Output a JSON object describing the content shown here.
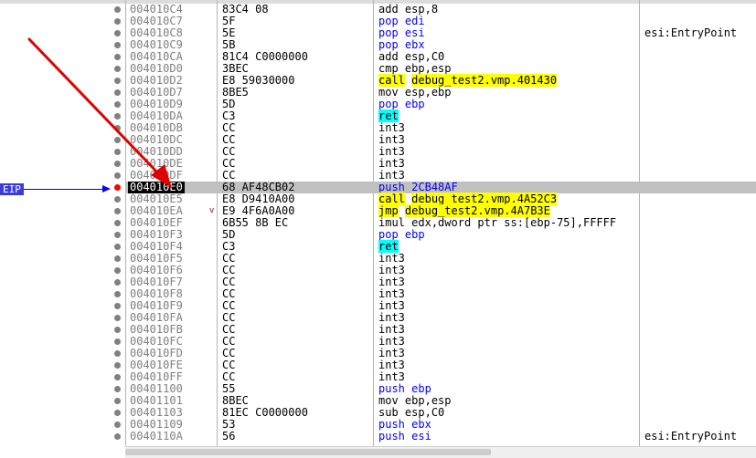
{
  "eip_marker": {
    "label": "EIP"
  },
  "rows": [
    {
      "addr": "004010C4",
      "bytes": "83C4 08",
      "mn": "add",
      "ops": "esp,8",
      "cls": "mn-default"
    },
    {
      "addr": "004010C7",
      "bytes": "5F",
      "mn": "pop",
      "ops": "edi",
      "cls": "mn-stack"
    },
    {
      "addr": "004010C8",
      "bytes": "5E",
      "mn": "pop",
      "ops": "esi",
      "cls": "mn-stack",
      "comment": "esi:EntryPoint"
    },
    {
      "addr": "004010C9",
      "bytes": "5B",
      "mn": "pop",
      "ops": "ebx",
      "cls": "mn-stack"
    },
    {
      "addr": "004010CA",
      "bytes": "81C4 C0000000",
      "mn": "add",
      "ops": "esp,C0",
      "cls": "mn-default"
    },
    {
      "addr": "004010D0",
      "bytes": "3BEC",
      "mn": "cmp",
      "ops": "ebp,esp",
      "cls": "mn-default"
    },
    {
      "addr": "004010D2",
      "bytes": "E8 59030000",
      "mn": "call",
      "ops": "debug_test2.vmp.401430",
      "cls": "mn-call"
    },
    {
      "addr": "004010D7",
      "bytes": "8BE5",
      "mn": "mov",
      "ops": "esp,ebp",
      "cls": "mn-default"
    },
    {
      "addr": "004010D9",
      "bytes": "5D",
      "mn": "pop",
      "ops": "ebp",
      "cls": "mn-stack"
    },
    {
      "addr": "004010DA",
      "bytes": "C3",
      "mn": "ret",
      "ops": "",
      "cls": "mn-ret"
    },
    {
      "addr": "004010DB",
      "bytes": "CC",
      "mn": "int3",
      "ops": "",
      "cls": "mn-default"
    },
    {
      "addr": "004010DC",
      "bytes": "CC",
      "mn": "int3",
      "ops": "",
      "cls": "mn-default"
    },
    {
      "addr": "004010DD",
      "bytes": "CC",
      "mn": "int3",
      "ops": "",
      "cls": "mn-default"
    },
    {
      "addr": "004010DE",
      "bytes": "CC",
      "mn": "int3",
      "ops": "",
      "cls": "mn-default"
    },
    {
      "addr": "004010DF",
      "bytes": "CC",
      "mn": "int3",
      "ops": "",
      "cls": "mn-default"
    },
    {
      "addr": "004010E0",
      "bytes": "68 AF48CB02",
      "mn": "push",
      "ops": "2CB48AF",
      "cls": "mn-stack",
      "eip": true,
      "bp": true
    },
    {
      "addr": "004010E5",
      "bytes": "E8 D9410A00",
      "mn": "call",
      "ops": "debug_test2.vmp.4A52C3",
      "cls": "mn-call"
    },
    {
      "addr": "004010EA",
      "bytes": "E9 4F6A0A00",
      "mn": "jmp",
      "ops": "debug_test2.vmp.4A7B3E",
      "cls": "mn-jmp",
      "jmark": "v"
    },
    {
      "addr": "004010EF",
      "bytes": "6B55 8B EC",
      "mn": "imul",
      "ops": "edx,dword ptr ss:[ebp-75],FFFFF",
      "cls": "mn-default"
    },
    {
      "addr": "004010F3",
      "bytes": "5D",
      "mn": "pop",
      "ops": "ebp",
      "cls": "mn-stack"
    },
    {
      "addr": "004010F4",
      "bytes": "C3",
      "mn": "ret",
      "ops": "",
      "cls": "mn-ret"
    },
    {
      "addr": "004010F5",
      "bytes": "CC",
      "mn": "int3",
      "ops": "",
      "cls": "mn-default"
    },
    {
      "addr": "004010F6",
      "bytes": "CC",
      "mn": "int3",
      "ops": "",
      "cls": "mn-default"
    },
    {
      "addr": "004010F7",
      "bytes": "CC",
      "mn": "int3",
      "ops": "",
      "cls": "mn-default"
    },
    {
      "addr": "004010F8",
      "bytes": "CC",
      "mn": "int3",
      "ops": "",
      "cls": "mn-default"
    },
    {
      "addr": "004010F9",
      "bytes": "CC",
      "mn": "int3",
      "ops": "",
      "cls": "mn-default"
    },
    {
      "addr": "004010FA",
      "bytes": "CC",
      "mn": "int3",
      "ops": "",
      "cls": "mn-default"
    },
    {
      "addr": "004010FB",
      "bytes": "CC",
      "mn": "int3",
      "ops": "",
      "cls": "mn-default"
    },
    {
      "addr": "004010FC",
      "bytes": "CC",
      "mn": "int3",
      "ops": "",
      "cls": "mn-default"
    },
    {
      "addr": "004010FD",
      "bytes": "CC",
      "mn": "int3",
      "ops": "",
      "cls": "mn-default"
    },
    {
      "addr": "004010FE",
      "bytes": "CC",
      "mn": "int3",
      "ops": "",
      "cls": "mn-default"
    },
    {
      "addr": "004010FF",
      "bytes": "CC",
      "mn": "int3",
      "ops": "",
      "cls": "mn-default"
    },
    {
      "addr": "00401100",
      "bytes": "55",
      "mn": "push",
      "ops": "ebp",
      "cls": "mn-stack"
    },
    {
      "addr": "00401101",
      "bytes": "8BEC",
      "mn": "mov",
      "ops": "ebp,esp",
      "cls": "mn-default"
    },
    {
      "addr": "00401103",
      "bytes": "81EC C0000000",
      "mn": "sub",
      "ops": "esp,C0",
      "cls": "mn-default"
    },
    {
      "addr": "00401109",
      "bytes": "53",
      "mn": "push",
      "ops": "ebx",
      "cls": "mn-stack"
    },
    {
      "addr": "0040110A",
      "bytes": "56",
      "mn": "push",
      "ops": "esi",
      "cls": "mn-stack",
      "comment": "esi:EntryPoint"
    }
  ],
  "colors": {
    "stack_op": "#0000ff",
    "call_highlight": "#ffff00",
    "ret_highlight": "#00ffff",
    "eip_label_bg": "#3b3bd8",
    "selected_row": "#c0c0c0",
    "breakpoint": "#ff0000",
    "annotation_arrow": "#e00000"
  },
  "icons": {
    "breakpoint": "breakpoint-dot-icon",
    "eip_arrow": "eip-arrow-icon",
    "annotation": "red-annotation-arrow-icon"
  }
}
